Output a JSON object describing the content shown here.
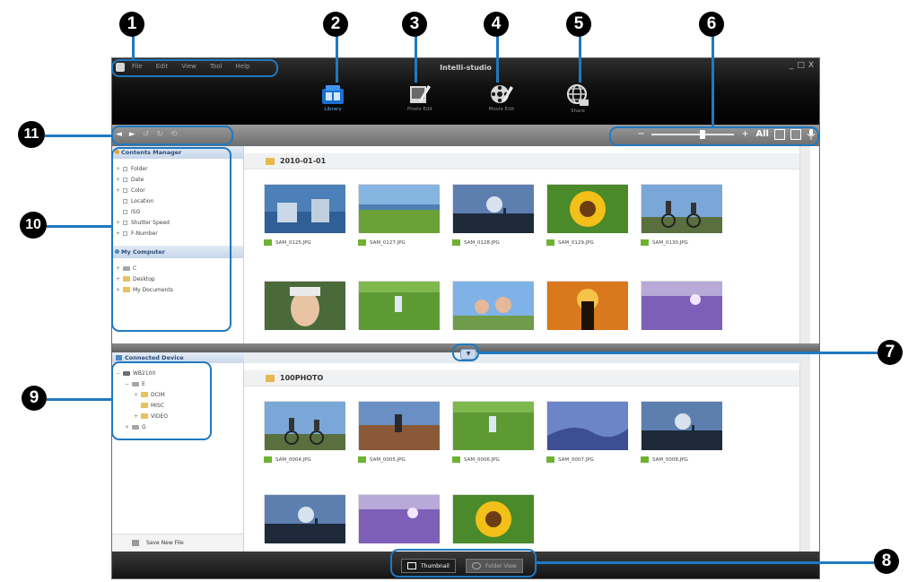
{
  "window": {
    "title": "Intelli-studio",
    "menu": [
      "File",
      "Edit",
      "View",
      "Tool",
      "Help"
    ],
    "controls": [
      "_",
      "□",
      "X"
    ]
  },
  "modes": [
    {
      "label": "Library",
      "icon": "library-icon",
      "active": true
    },
    {
      "label": "Photo Edit",
      "icon": "photo-edit-icon",
      "active": false
    },
    {
      "label": "Movie Edit",
      "icon": "movie-edit-icon",
      "active": false
    },
    {
      "label": "Share",
      "icon": "share-globe-icon",
      "active": false
    }
  ],
  "toolbar": {
    "nav": [
      "◄",
      "►",
      "↺",
      "↻",
      "⟲"
    ],
    "zoom_minus": "−",
    "zoom_plus": "+",
    "zoom_level": 0.62,
    "all_label": "All"
  },
  "contents_manager": {
    "title": "Contents Manager",
    "items": [
      "Folder",
      "Date",
      "Color",
      "Location",
      "ISO",
      "Shutter Speed",
      "F-Number"
    ],
    "expandable": [
      true,
      true,
      true,
      false,
      false,
      true,
      true
    ]
  },
  "my_computer": {
    "title": "My Computer",
    "items": [
      "C",
      "Desktop",
      "My Documents"
    ]
  },
  "upper_folder": {
    "name": "2010-01-01",
    "photos": [
      {
        "file": "SAM_0125.JPG",
        "scene": "blue-lake"
      },
      {
        "file": "SAM_0127.JPG",
        "scene": "green-field"
      },
      {
        "file": "SAM_0128.JPG",
        "scene": "dusk-walker"
      },
      {
        "file": "SAM_0129.JPG",
        "scene": "sunflower"
      },
      {
        "file": "SAM_0130.JPG",
        "scene": "cyclists"
      },
      {
        "file": "",
        "scene": "portrait"
      },
      {
        "file": "",
        "scene": "grass-run"
      },
      {
        "file": "",
        "scene": "family"
      },
      {
        "file": "",
        "scene": "orange-sunset"
      },
      {
        "file": "",
        "scene": "lavender"
      }
    ]
  },
  "connected_device": {
    "title": "Connected Device",
    "tree": [
      {
        "label": "WB2100",
        "level": 0,
        "kind": "device",
        "expander": "−"
      },
      {
        "label": "E",
        "level": 1,
        "kind": "drive",
        "expander": "−"
      },
      {
        "label": "DCIM",
        "level": 2,
        "kind": "folder",
        "expander": "+"
      },
      {
        "label": "MISC",
        "level": 2,
        "kind": "folder",
        "expander": ""
      },
      {
        "label": "VIDEO",
        "level": 2,
        "kind": "folder",
        "expander": "+"
      },
      {
        "label": "G",
        "level": 1,
        "kind": "drive",
        "expander": "+"
      }
    ],
    "save_label": "Save New File"
  },
  "lower_folder": {
    "name": "100PHOTO",
    "photos": [
      {
        "file": "SAM_0004.JPG",
        "scene": "cyclists"
      },
      {
        "file": "SAM_0005.JPG",
        "scene": "hiker"
      },
      {
        "file": "SAM_0006.JPG",
        "scene": "grass-run"
      },
      {
        "file": "SAM_0007.JPG",
        "scene": "blue-hills"
      },
      {
        "file": "SAM_0008.JPG",
        "scene": "dusk-walker"
      },
      {
        "file": "",
        "scene": "dusk-walker"
      },
      {
        "file": "",
        "scene": "lavender"
      },
      {
        "file": "",
        "scene": "sunflower"
      }
    ]
  },
  "status_bar": {
    "buttons": [
      "Thumbnail",
      "Folder View"
    ]
  },
  "callouts": [
    "1",
    "2",
    "3",
    "4",
    "5",
    "6",
    "7",
    "8",
    "9",
    "10",
    "11"
  ],
  "colors": {
    "callout": "#1f79c2",
    "badge": "#000000",
    "active_mode": "#6fb2ff"
  }
}
